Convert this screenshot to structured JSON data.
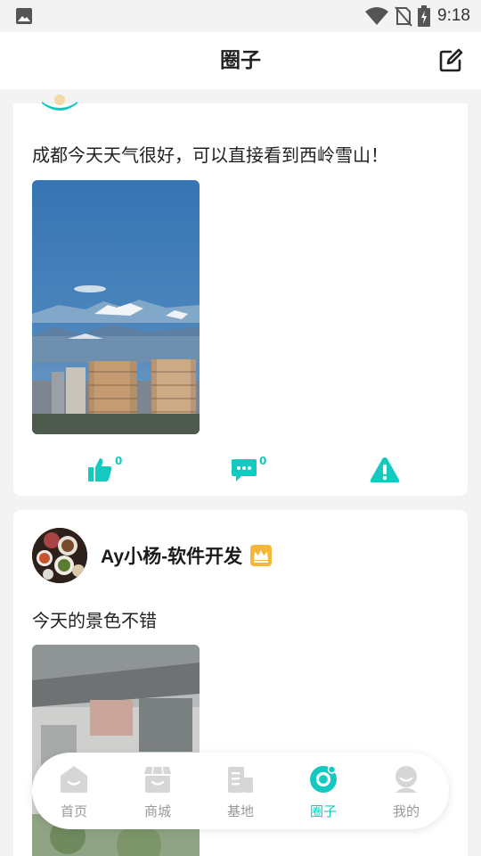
{
  "status_bar": {
    "time": "9:18"
  },
  "header": {
    "title": "圈子"
  },
  "posts": [
    {
      "text": "成都今天天气很好，可以直接看到西岭雪山！",
      "likes": "0",
      "comments": "0"
    },
    {
      "author": "Ay小杨-软件开发",
      "text": "今天的景色不错"
    }
  ],
  "tabbar": {
    "items": [
      {
        "label": "首页",
        "icon": "home-icon"
      },
      {
        "label": "商城",
        "icon": "store-icon"
      },
      {
        "label": "基地",
        "icon": "base-icon"
      },
      {
        "label": "圈子",
        "icon": "circle-icon",
        "active": true
      },
      {
        "label": "我的",
        "icon": "profile-icon"
      }
    ]
  },
  "colors": {
    "accent": "#13c9c0",
    "inactive": "#cccccc"
  }
}
